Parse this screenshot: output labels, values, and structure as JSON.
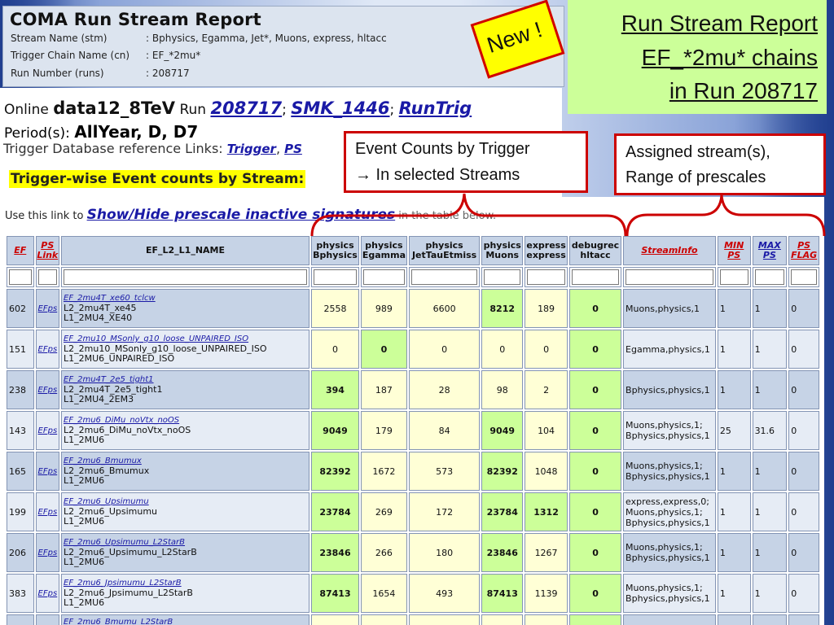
{
  "report": {
    "title": "COMA Run Stream Report",
    "meta": [
      {
        "key": "Stream Name (stm)",
        "value": ": Bphysics, Egamma, Jet*, Muons, express, hltacc"
      },
      {
        "key": "Trigger Chain Name (cn)",
        "value": ": EF_*2mu*"
      },
      {
        "key": "Run Number (runs)",
        "value": ": 208717"
      }
    ]
  },
  "online": {
    "prefix": "Online",
    "project": "data12_8TeV",
    "run_label": "Run",
    "run": "208717",
    "smk": "SMK_1446",
    "runtrig": "RunTrig",
    "periods_label": "Period(s):",
    "periods": "AllYear, D, D7",
    "refs_label": "Trigger Database reference Links:",
    "ref1": "Trigger",
    "ref2": "PS"
  },
  "section_title": "Trigger-wise Event counts by Stream:",
  "link_line": {
    "pre": "Use this link to",
    "link": "Show/Hide prescale inactive signatures",
    "post": "in the table below."
  },
  "new_badge": "New !",
  "slide_title": [
    "Run Stream Report",
    "EF_*2mu* chains",
    "in Run 208717"
  ],
  "callout_counts": [
    "Event Counts by Trigger",
    "→  In selected Streams"
  ],
  "callout_streams": [
    "Assigned stream(s),",
    "Range of prescales"
  ],
  "colors": {
    "accent_red": "#cc0000",
    "green_cell": "#ccff99",
    "yellow_cell": "#ffffd6",
    "header_blue": "#c6d3e6"
  },
  "table": {
    "headers": {
      "ef": "EF",
      "pslink": [
        "PS",
        "Link"
      ],
      "name": "EF_L2_L1_NAME",
      "bphys": [
        "physics",
        "Bphysics"
      ],
      "egamma": [
        "physics",
        "Egamma"
      ],
      "jet": [
        "physics",
        "JetTauEtmiss"
      ],
      "muons": [
        "physics",
        "Muons"
      ],
      "express": [
        "express",
        "express"
      ],
      "hltacc": [
        "debugrec",
        "hltacc"
      ],
      "streaminfo": "StreamInfo",
      "minps": [
        "MIN",
        "PS"
      ],
      "maxps": [
        "MAX",
        "PS"
      ],
      "psflag": [
        "PS",
        "FLAG"
      ]
    },
    "rows": [
      {
        "id": "602",
        "ps": "EFps",
        "ef": "EF_2mu4T_xe60_tclcw",
        "l2": "L2_2mu4T_xe45",
        "l1": "L1_2MU4_XE40",
        "bphys": "2558",
        "egamma": "989",
        "jet": "6600",
        "muons": "8212",
        "express": "189",
        "hltacc": "0",
        "si": [
          "Muons,physics,1"
        ],
        "min": "1",
        "max": "1",
        "flag": "0",
        "green": [
          "muons"
        ]
      },
      {
        "id": "151",
        "ps": "EFps",
        "ef": "EF_2mu10_MSonly_g10_loose_UNPAIRED_ISO",
        "l2": "L2_2mu10_MSonly_g10_loose_UNPAIRED_ISO",
        "l1": "L1_2MU6_UNPAIRED_ISO",
        "bphys": "0",
        "egamma": "0",
        "jet": "0",
        "muons": "0",
        "express": "0",
        "hltacc": "0",
        "si": [
          "Egamma,physics,1"
        ],
        "min": "1",
        "max": "1",
        "flag": "0",
        "green": [
          "egamma"
        ]
      },
      {
        "id": "238",
        "ps": "EFps",
        "ef": "EF_2mu4T_2e5_tight1",
        "l2": "L2_2mu4T_2e5_tight1",
        "l1": "L1_2MU4_2EM3",
        "bphys": "394",
        "egamma": "187",
        "jet": "28",
        "muons": "98",
        "express": "2",
        "hltacc": "0",
        "si": [
          "Bphysics,physics,1"
        ],
        "min": "1",
        "max": "1",
        "flag": "0",
        "green": [
          "bphys"
        ]
      },
      {
        "id": "143",
        "ps": "EFps",
        "ef": "EF_2mu6_DiMu_noVtx_noOS",
        "l2": "L2_2mu6_DiMu_noVtx_noOS",
        "l1": "L1_2MU6",
        "bphys": "9049",
        "egamma": "179",
        "jet": "84",
        "muons": "9049",
        "express": "104",
        "hltacc": "0",
        "si": [
          "Muons,physics,1;",
          "Bphysics,physics,1"
        ],
        "min": "25",
        "max": "31.6",
        "flag": "0",
        "green": [
          "bphys",
          "muons"
        ]
      },
      {
        "id": "165",
        "ps": "EFps",
        "ef": "EF_2mu6_Bmumux",
        "l2": "L2_2mu6_Bmumux",
        "l1": "L1_2MU6",
        "bphys": "82392",
        "egamma": "1672",
        "jet": "573",
        "muons": "82392",
        "express": "1048",
        "hltacc": "0",
        "si": [
          "Muons,physics,1;",
          "Bphysics,physics,1"
        ],
        "min": "1",
        "max": "1",
        "flag": "0",
        "green": [
          "bphys",
          "muons"
        ]
      },
      {
        "id": "199",
        "ps": "EFps",
        "ef": "EF_2mu6_Upsimumu",
        "l2": "L2_2mu6_Upsimumu",
        "l1": "L1_2MU6",
        "bphys": "23784",
        "egamma": "269",
        "jet": "172",
        "muons": "23784",
        "express": "1312",
        "hltacc": "0",
        "si": [
          "express,express,0;",
          "Muons,physics,1;",
          "Bphysics,physics,1"
        ],
        "min": "1",
        "max": "1",
        "flag": "0",
        "green": [
          "bphys",
          "muons",
          "express"
        ]
      },
      {
        "id": "206",
        "ps": "EFps",
        "ef": "EF_2mu6_Upsimumu_L2StarB",
        "l2": "L2_2mu6_Upsimumu_L2StarB",
        "l1": "L1_2MU6",
        "bphys": "23846",
        "egamma": "266",
        "jet": "180",
        "muons": "23846",
        "express": "1267",
        "hltacc": "0",
        "si": [
          "Muons,physics,1;",
          "Bphysics,physics,1"
        ],
        "min": "1",
        "max": "1",
        "flag": "0",
        "green": [
          "bphys",
          "muons"
        ]
      },
      {
        "id": "383",
        "ps": "EFps",
        "ef": "EF_2mu6_Jpsimumu_L2StarB",
        "l2": "L2_2mu6_Jpsimumu_L2StarB",
        "l1": "L1_2MU6",
        "bphys": "87413",
        "egamma": "1654",
        "jet": "493",
        "muons": "87413",
        "express": "1139",
        "hltacc": "0",
        "si": [
          "Muons,physics,1;",
          "Bphysics,physics,1"
        ],
        "min": "1",
        "max": "1",
        "flag": "0",
        "green": [
          "bphys",
          "muons"
        ]
      },
      {
        "id": "",
        "ps": "",
        "ef": "EF_2mu6_Bmumu_L2StarB",
        "l2": "",
        "l1": "",
        "bphys": "",
        "egamma": "",
        "jet": "",
        "muons": "",
        "express": "",
        "hltacc": "",
        "si": [],
        "min": "",
        "max": "",
        "flag": "",
        "green": []
      }
    ]
  }
}
